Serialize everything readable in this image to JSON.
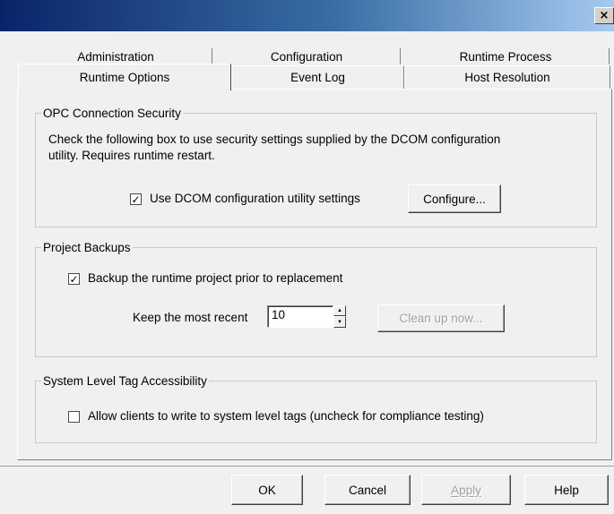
{
  "window": {
    "title": "",
    "close_glyph": "×",
    "close_icon": "close-icon"
  },
  "tabs": {
    "row1": [
      "Administration",
      "Configuration",
      "Runtime Process"
    ],
    "row2": [
      "Runtime Options",
      "Event Log",
      "Host Resolution"
    ],
    "active": "Runtime Options"
  },
  "opc_security": {
    "title": "OPC Connection Security",
    "description_line1": "Check the following box to use security settings supplied by the DCOM configuration",
    "description_line2": "utility.  Requires runtime restart.",
    "checkbox_label": "Use DCOM configuration utility settings",
    "checkbox_checked": true,
    "configure_button": "Configure..."
  },
  "project_backups": {
    "title": "Project Backups",
    "checkbox_label": "Backup the runtime project prior to replacement",
    "checkbox_checked": true,
    "keep_label": "Keep the most recent",
    "keep_value": "10",
    "cleanup_button": "Clean up now..."
  },
  "system_tags": {
    "title": "System Level Tag Accessibility",
    "checkbox_label": "Allow clients to write to system level tags (uncheck for compliance testing)",
    "checkbox_checked": false
  },
  "footer": {
    "ok": "OK",
    "cancel": "Cancel",
    "apply": "Apply",
    "help": "Help"
  },
  "glyphs": {
    "check": "✓",
    "spin_up": "▲",
    "spin_down": "▼"
  },
  "colors": {
    "face": "#f0f0f0",
    "title_gradient_start": "#0a246a",
    "disabled_text": "#a0a0a0"
  }
}
